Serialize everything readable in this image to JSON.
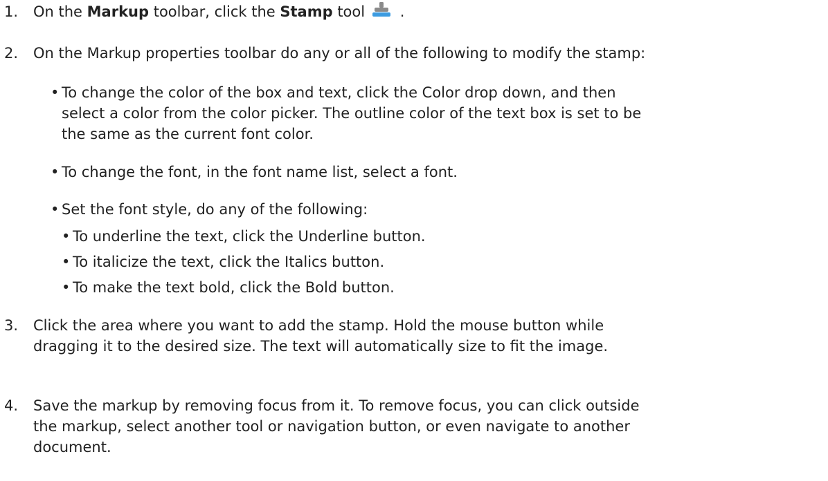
{
  "steps": [
    {
      "number": "1.",
      "text_before": "On the ",
      "keyword1": "Markup",
      "text_middle": " toolbar, click the ",
      "keyword2": "Stamp",
      "text_after": " tool",
      "text_end": " .",
      "icon": "stamp-icon",
      "icon_colors": {
        "body": "#8a8a8a",
        "base": "#3c9be0"
      }
    },
    {
      "number": "2.",
      "text": "On the Markup properties toolbar do any or all of the following to modify the stamp:"
    },
    {
      "number": "3.",
      "text_line1": "Click the area where you want to add the stamp.  Hold the mouse button while",
      "text_line2": "dragging it to the desired size.  The text will automatically size to fit the image."
    },
    {
      "number": "4.",
      "text_line1": "Save the markup by removing focus from it.  To remove focus, you can click outside",
      "text_line2": "the markup, select another tool or navigation button, or even navigate to another",
      "text_line3": "document."
    }
  ],
  "bullets": {
    "color": {
      "line1": "To change the color of the box and text, click the Color drop down, and then",
      "line2": "select a color from the color picker.  The outline color of the text box is set to be",
      "line3": "the same as the current font color."
    },
    "font": "To change the font, in the font name list, select a font.",
    "style": "Set the font style, do any of the following:"
  },
  "sub_bullets": [
    "To underline the text, click the Underline button.",
    "To italicize the text, click the Italics button.",
    "To make the text bold, click the Bold button."
  ],
  "bullet_glyph": "•"
}
